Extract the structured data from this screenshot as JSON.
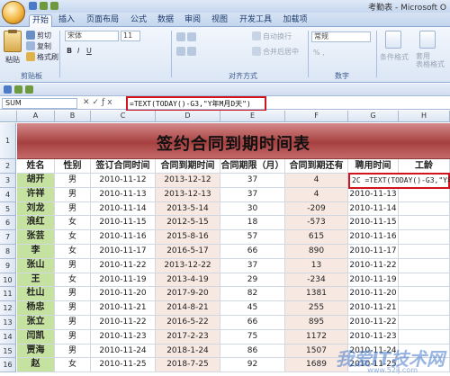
{
  "window": {
    "title": "考勤表 - Microsoft O"
  },
  "tabs": [
    "开始",
    "插入",
    "页面布局",
    "公式",
    "数据",
    "审阅",
    "视图",
    "开发工具",
    "加载项"
  ],
  "ribbon": {
    "paste": "粘贴",
    "cut": "剪切",
    "copy": "复制",
    "format_painter": "格式刷",
    "clipboard": "剪贴板",
    "wrap": "自动换行",
    "merge": "合并后居中",
    "alignment": "对齐方式",
    "number_format": "常规",
    "number": "数字",
    "cond_format": "条件格式",
    "table_format": "套用\n表格格式",
    "font_name": "宋体",
    "font_size": "11"
  },
  "formula_bar": {
    "name_box": "SUM",
    "formula": "=TEXT(TODAY()-G3,\"Y年M月D天\")"
  },
  "columns": [
    "A",
    "B",
    "C",
    "D",
    "E",
    "F",
    "G",
    "H"
  ],
  "sheet_title": "签约合同到期时间表",
  "headers": [
    "姓名",
    "性别",
    "签订合同时间",
    "合同到期时间",
    "合同期限（月）",
    "合同到期还有",
    "聘用时间",
    "工龄"
  ],
  "editing_cell": "2C =TEXT(TODAY()-G3,\"Y年",
  "rows": [
    {
      "n": "3",
      "name": "胡开",
      "sex": "男",
      "sign": "2010-11-12",
      "end": "2013-12-12",
      "months": "37",
      "left": "4",
      "hire": "",
      "age": ""
    },
    {
      "n": "4",
      "name": "许祥",
      "sex": "男",
      "sign": "2010-11-13",
      "end": "2013-12-13",
      "months": "37",
      "left": "4",
      "hire": "2010-11-13",
      "age": ""
    },
    {
      "n": "5",
      "name": "刘龙",
      "sex": "男",
      "sign": "2010-11-14",
      "end": "2013-5-14",
      "months": "30",
      "left": "-209",
      "hire": "2010-11-14",
      "age": ""
    },
    {
      "n": "6",
      "name": "浪红",
      "sex": "女",
      "sign": "2010-11-15",
      "end": "2012-5-15",
      "months": "18",
      "left": "-573",
      "hire": "2010-11-15",
      "age": ""
    },
    {
      "n": "7",
      "name": "张芸",
      "sex": "女",
      "sign": "2010-11-16",
      "end": "2015-8-16",
      "months": "57",
      "left": "615",
      "hire": "2010-11-16",
      "age": ""
    },
    {
      "n": "8",
      "name": "李",
      "sex": "女",
      "sign": "2010-11-17",
      "end": "2016-5-17",
      "months": "66",
      "left": "890",
      "hire": "2010-11-17",
      "age": ""
    },
    {
      "n": "9",
      "name": "张山",
      "sex": "男",
      "sign": "2010-11-22",
      "end": "2013-12-22",
      "months": "37",
      "left": "13",
      "hire": "2010-11-22",
      "age": ""
    },
    {
      "n": "10",
      "name": "王",
      "sex": "女",
      "sign": "2010-11-19",
      "end": "2013-4-19",
      "months": "29",
      "left": "-234",
      "hire": "2010-11-19",
      "age": ""
    },
    {
      "n": "11",
      "name": "杜山",
      "sex": "男",
      "sign": "2010-11-20",
      "end": "2017-9-20",
      "months": "82",
      "left": "1381",
      "hire": "2010-11-20",
      "age": ""
    },
    {
      "n": "12",
      "name": "杨忠",
      "sex": "男",
      "sign": "2010-11-21",
      "end": "2014-8-21",
      "months": "45",
      "left": "255",
      "hire": "2010-11-21",
      "age": ""
    },
    {
      "n": "13",
      "name": "张立",
      "sex": "男",
      "sign": "2010-11-22",
      "end": "2016-5-22",
      "months": "66",
      "left": "895",
      "hire": "2010-11-22",
      "age": ""
    },
    {
      "n": "14",
      "name": "闫凯",
      "sex": "男",
      "sign": "2010-11-23",
      "end": "2017-2-23",
      "months": "75",
      "left": "1172",
      "hire": "2010-11-23",
      "age": ""
    },
    {
      "n": "15",
      "name": "贾海",
      "sex": "男",
      "sign": "2010-11-24",
      "end": "2018-1-24",
      "months": "86",
      "left": "1507",
      "hire": "2010-11-24",
      "age": ""
    },
    {
      "n": "16",
      "name": "赵",
      "sex": "女",
      "sign": "2010-11-25",
      "end": "2018-7-25",
      "months": "92",
      "left": "1689",
      "hire": "2010-11-25",
      "age": ""
    }
  ],
  "watermark": {
    "main": "我爱IT技术网",
    "sub": "www.52ij.com"
  }
}
